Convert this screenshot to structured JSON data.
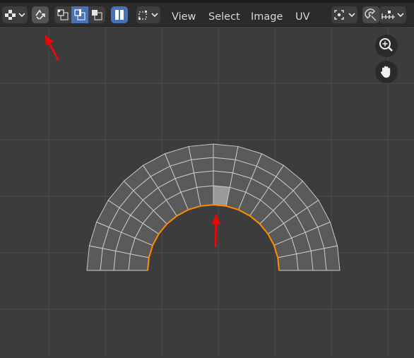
{
  "header": {
    "menus": [
      {
        "label": "View"
      },
      {
        "label": "Select"
      },
      {
        "label": "Image"
      },
      {
        "label": "UV"
      }
    ],
    "buttons": {
      "editor_type": {
        "icon": "uv-editor-icon"
      },
      "sync_selection": {
        "icon": "sync-selection-icon",
        "active": false
      },
      "select_modes": [
        {
          "icon": "vertex-select-icon",
          "active": false
        },
        {
          "icon": "edge-select-icon",
          "active": true
        },
        {
          "icon": "face-select-icon",
          "active": false
        }
      ],
      "island_select": {
        "icon": "island-select-icon",
        "active": true
      },
      "sticky_select": {
        "icon": "sticky-select-mode-icon"
      },
      "pivot": {
        "icon": "pivot-point-icon"
      },
      "snap": {
        "icon": "snap-magnet-icon"
      },
      "snap_target": {
        "icon": "snap-increment-icon"
      }
    }
  },
  "viewport": {
    "nav_controls": [
      {
        "icon": "zoom-icon"
      },
      {
        "icon": "pan-hand-icon"
      }
    ],
    "uv_mesh": {
      "shape": "half-ring",
      "rings": 4,
      "segments": 16,
      "selected_edge_loop": "inner boundary",
      "selected_face": "inner ring, just right of top center"
    },
    "annotations": [
      {
        "type": "arrow",
        "color": "#ff0000",
        "points_to": "sync-selection-button"
      },
      {
        "type": "arrow",
        "color": "#ff0000",
        "points_to": "selected inner edge loop"
      }
    ]
  },
  "colors": {
    "header_bg": "#2b2b2b",
    "viewport_bg": "#3c3c3c",
    "grid": "#4a4a4a",
    "mesh_face": "#5a5a5a",
    "mesh_edge": "#c8c8c8",
    "selected_edge": "#ff8c00",
    "selected_face": "#9a9a9a",
    "accent_active": "#4772b3",
    "annotation": "#ff0000"
  }
}
